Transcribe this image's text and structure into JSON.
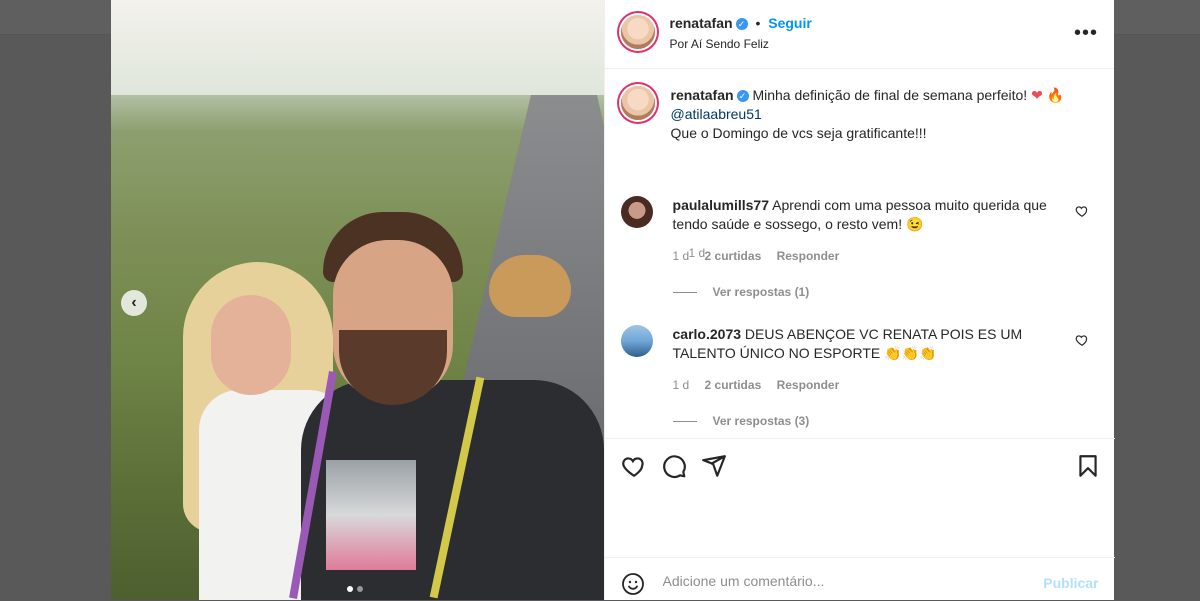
{
  "post": {
    "username": "renatafan",
    "follow_label": "Seguir",
    "location": "Por Aí Sendo Feliz",
    "more_icon": "more-options-icon",
    "caption_line1": "Minha definição de final de semana perfeito! ",
    "caption_mention": "@atilaabreu51",
    "caption_line2": "Que o Domingo de vcs seja gratificante!!!",
    "caption_time": "1 d"
  },
  "comments": [
    {
      "username": "paulalumills77",
      "text": "Aprendi com uma pessoa muito querida que tendo saúde e sossego, o resto vem! 😉",
      "time": "1 d",
      "likes": "2 curtidas",
      "reply": "Responder",
      "view_replies": "Ver respostas (1)"
    },
    {
      "username": "carlo.2073",
      "text": "DEUS ABENÇOE VC RENATA POIS ES UM TALENTO ÚNICO NO ESPORTE 👏👏👏",
      "time": "1 d",
      "likes": "2 curtidas",
      "reply": "Responder",
      "view_replies": "Ver respostas (3)"
    }
  ],
  "composer": {
    "placeholder": "Adicione um comentário...",
    "publish_label": "Publicar"
  },
  "colors": {
    "accent": "#0095f6",
    "like_red": "#ed4956",
    "backdrop": "#595959"
  }
}
